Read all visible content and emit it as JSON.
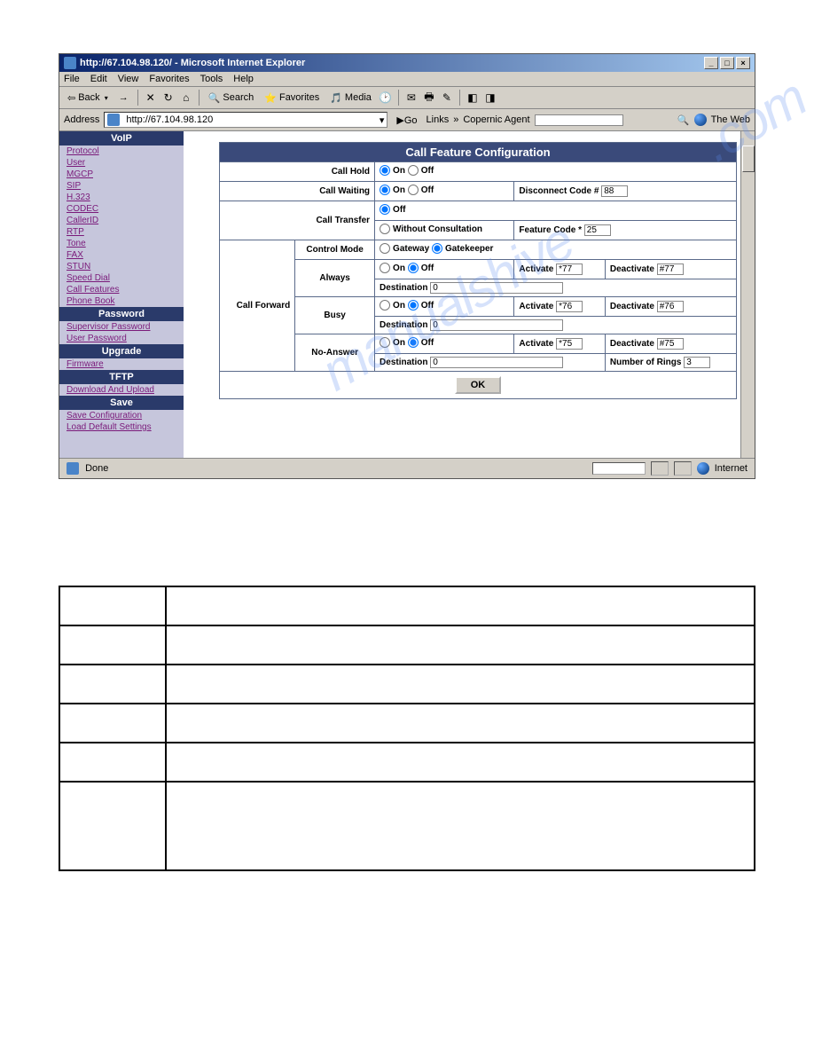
{
  "window": {
    "title": "http://67.104.98.120/ - Microsoft Internet Explorer",
    "minimize": "_",
    "restore": "□",
    "close": "×"
  },
  "menu": [
    "File",
    "Edit",
    "View",
    "Favorites",
    "Tools",
    "Help"
  ],
  "toolbar": {
    "back": "Back",
    "search": "Search",
    "favorites": "Favorites",
    "media": "Media"
  },
  "address": {
    "label": "Address",
    "url": "http://67.104.98.120",
    "go": "Go",
    "links": "Links",
    "agent_label": "Copernic Agent",
    "agent_value": "",
    "web": "The Web"
  },
  "sidebar": {
    "sections": [
      {
        "header": "VoIP",
        "links": [
          "Protocol",
          "User",
          "MGCP",
          "SIP",
          "H.323",
          "CODEC",
          "CallerID",
          "RTP",
          "Tone",
          "FAX",
          "STUN",
          "Speed Dial",
          "Call Features",
          "Phone Book"
        ]
      },
      {
        "header": "Password",
        "links": [
          "Supervisor Password",
          "User Password"
        ]
      },
      {
        "header": "Upgrade",
        "links": [
          "Firmware"
        ]
      },
      {
        "header": "TFTP",
        "links": [
          "Download And Upload"
        ]
      },
      {
        "header": "Save",
        "links": [
          "Save Configuration",
          "Load Default Settings"
        ]
      }
    ]
  },
  "form": {
    "title": "Call Feature Configuration",
    "call_hold": "Call Hold",
    "call_waiting": "Call Waiting",
    "call_transfer": "Call Transfer",
    "call_forward": "Call Forward",
    "control_mode": "Control Mode",
    "always": "Always",
    "busy": "Busy",
    "no_answer": "No-Answer",
    "on": "On",
    "off": "Off",
    "without_consultation": "Without Consultation",
    "gateway": "Gateway",
    "gatekeeper": "Gatekeeper",
    "disconnect_code": "Disconnect Code #",
    "disconnect_value": "88",
    "feature_code": "Feature Code *",
    "feature_value": "25",
    "activate": "Activate",
    "deactivate": "Deactivate",
    "destination": "Destination",
    "always_act": "*77",
    "always_deact": "#77",
    "always_dest": "0",
    "busy_act": "*76",
    "busy_deact": "#76",
    "busy_dest": "0",
    "noans_act": "*75",
    "noans_deact": "#75",
    "noans_dest": "0",
    "num_rings": "Number of Rings",
    "num_rings_val": "3",
    "ok": "OK"
  },
  "status": {
    "done": "Done",
    "zone": "Internet"
  }
}
